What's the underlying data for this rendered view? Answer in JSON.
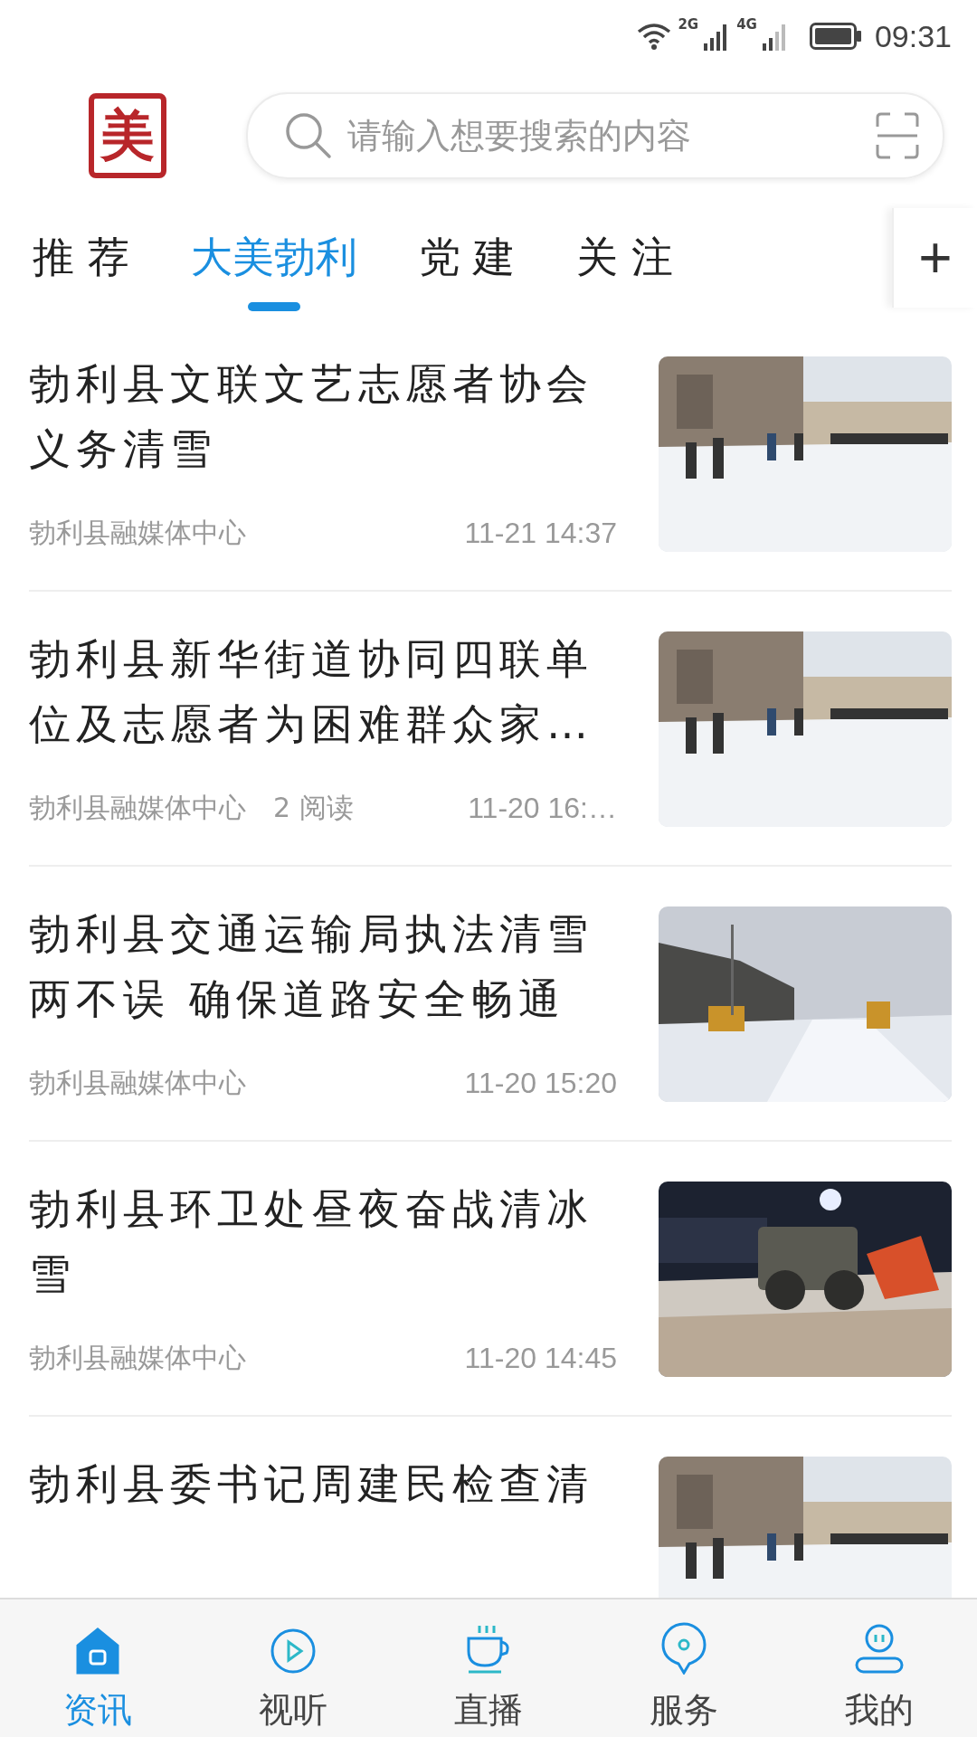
{
  "status_bar": {
    "network_1": "2G",
    "network_2": "4G",
    "time": "09:31"
  },
  "header": {
    "logo": "美",
    "search": {
      "placeholder": "请输入想要搜索的内容"
    }
  },
  "tabs": [
    {
      "label": "推 荐",
      "selected": false
    },
    {
      "label": "大美勃利",
      "selected": true
    },
    {
      "label": "党 建",
      "selected": false
    },
    {
      "label": "关 注",
      "selected": false
    }
  ],
  "add_tab": "+",
  "articles": [
    {
      "title": "勃利县文联文艺志愿者协会义务清雪",
      "source": "勃利县融媒体中心",
      "time": "11-21 14:37"
    },
    {
      "title": "勃利县新华街道协同四联单位及志愿者为困难群众家…",
      "source": "勃利县融媒体中心",
      "reads": "2 阅读",
      "time": "11-20 16:…"
    },
    {
      "title": "勃利县交通运输局执法清雪两不误 确保道路安全畅通",
      "source": "勃利县融媒体中心",
      "time": "11-20 15:20"
    },
    {
      "title": "勃利县环卫处昼夜奋战清冰雪",
      "source": "勃利县融媒体中心",
      "time": "11-20 14:45"
    },
    {
      "title": "勃利县委书记周建民检查清"
    }
  ],
  "bottom_nav": [
    {
      "label": "资讯",
      "selected": true
    },
    {
      "label": "视听",
      "selected": false
    },
    {
      "label": "直播",
      "selected": false
    },
    {
      "label": "服务",
      "selected": false
    },
    {
      "label": "我的",
      "selected": false
    }
  ]
}
